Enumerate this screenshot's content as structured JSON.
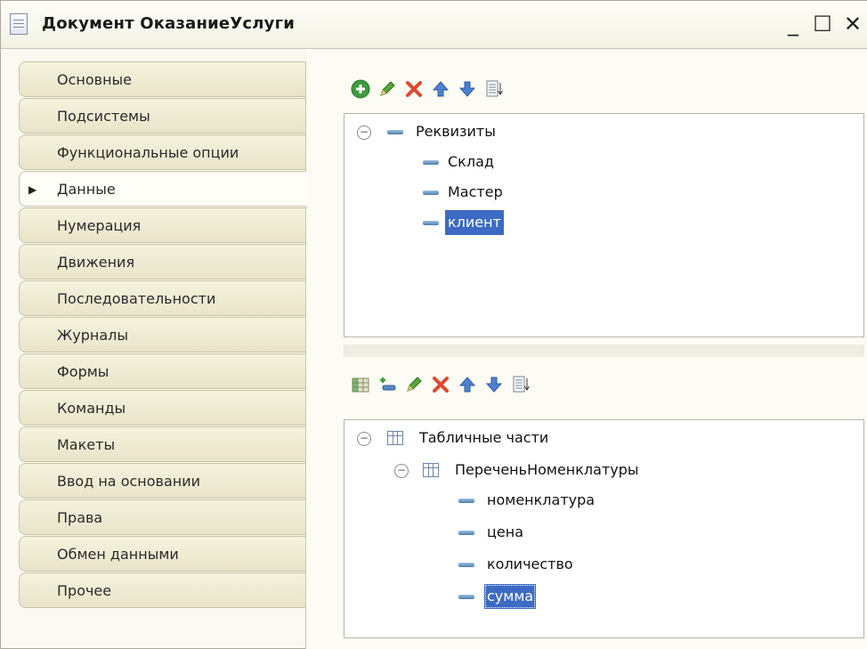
{
  "window": {
    "title": "Документ ОказаниеУслуги",
    "minimize_glyph": "_",
    "maximize_glyph": "☐",
    "close_glyph": "✕"
  },
  "tabs": [
    {
      "label": "Основные",
      "active": false
    },
    {
      "label": "Подсистемы",
      "active": false
    },
    {
      "label": "Функциональные опции",
      "active": false
    },
    {
      "label": "Данные",
      "active": true
    },
    {
      "label": "Нумерация",
      "active": false
    },
    {
      "label": "Движения",
      "active": false
    },
    {
      "label": "Последовательности",
      "active": false
    },
    {
      "label": "Журналы",
      "active": false
    },
    {
      "label": "Формы",
      "active": false
    },
    {
      "label": "Команды",
      "active": false
    },
    {
      "label": "Макеты",
      "active": false
    },
    {
      "label": "Ввод на основании",
      "active": false
    },
    {
      "label": "Права",
      "active": false
    },
    {
      "label": "Обмен данными",
      "active": false
    },
    {
      "label": "Прочее",
      "active": false
    }
  ],
  "attributes_tree": {
    "root": "Реквизиты",
    "items": [
      "Склад",
      "Мастер",
      "клиент"
    ],
    "selected": "клиент"
  },
  "tabular_tree": {
    "root": "Табличные части",
    "section": "ПереченьНоменклатуры",
    "items": [
      "номенклатура",
      "цена",
      "количество",
      "сумма"
    ],
    "selected": "сумма"
  },
  "icons": {
    "toolbar1": [
      "add-icon",
      "edit-icon",
      "delete-icon",
      "move-up-icon",
      "move-down-icon",
      "sort-icon"
    ],
    "toolbar2": [
      "add-table-icon",
      "add-row-icon",
      "edit-icon",
      "delete-icon",
      "move-up-icon",
      "move-down-icon",
      "sort-icon"
    ]
  },
  "colors": {
    "selection": "#3d6bc4",
    "add": "#3e9b3e",
    "delete": "#e0472f",
    "arrows": "#4f7fd0"
  }
}
